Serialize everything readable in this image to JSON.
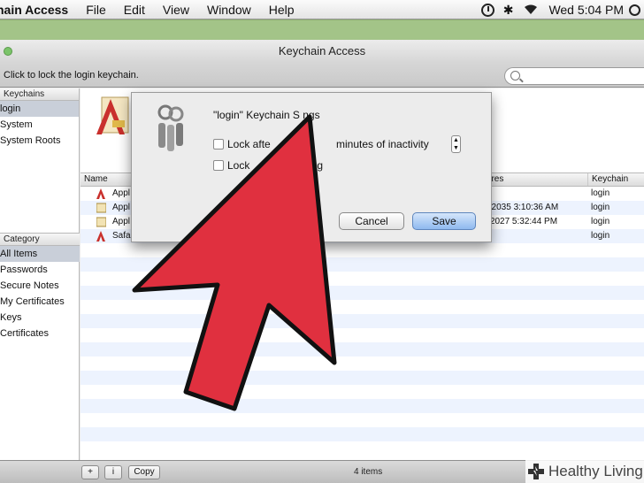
{
  "menubar": {
    "app": "hain Access",
    "items": [
      "File",
      "Edit",
      "View",
      "Window",
      "Help"
    ],
    "clock": "Wed 5:04 PM"
  },
  "window": {
    "title": "Keychain Access",
    "lock_hint": "Click to lock the login keychain.",
    "search_placeholder": ""
  },
  "sidebar": {
    "keychains_header": "Keychains",
    "keychains": [
      "login",
      "System",
      "System Roots"
    ],
    "category_header": "Category",
    "categories": [
      "All Items",
      "Passwords",
      "Secure Notes",
      "My Certificates",
      "Keys",
      "Certificates"
    ]
  },
  "table": {
    "columns": {
      "name": "Name",
      "expires": "Expires",
      "keychain": "Keychain"
    },
    "rows": [
      {
        "name": "Appl",
        "expires": "",
        "keychain": "login",
        "icon": "certificate-icon"
      },
      {
        "name": "Appl",
        "expires": "Feb-2035 3:10:36 AM",
        "keychain": "login",
        "icon": "certificate-icon"
      },
      {
        "name": "Appl",
        "expires": "Apr-2027 5:32:44 PM",
        "keychain": "login",
        "icon": "certificate-icon"
      },
      {
        "name": "Safa",
        "expires": "",
        "keychain": "login",
        "icon": "certificate-icon"
      }
    ]
  },
  "bottombar": {
    "plus": "+",
    "info": "i",
    "copy": "Copy",
    "count": "4 items"
  },
  "sheet": {
    "title": "\"login\" Keychain S    ngs",
    "opt1_prefix": "Lock afte",
    "opt1_suffix": "minutes of inactivity",
    "opt2_prefix": "Lock",
    "opt2_suffix": "ing",
    "cancel": "Cancel",
    "save": "Save"
  },
  "watermark": {
    "text": "Healthy Living"
  },
  "colors": {
    "arrow": "#e0303f",
    "save_button": "#8fb9ef",
    "selection": "#c9cfd9"
  }
}
